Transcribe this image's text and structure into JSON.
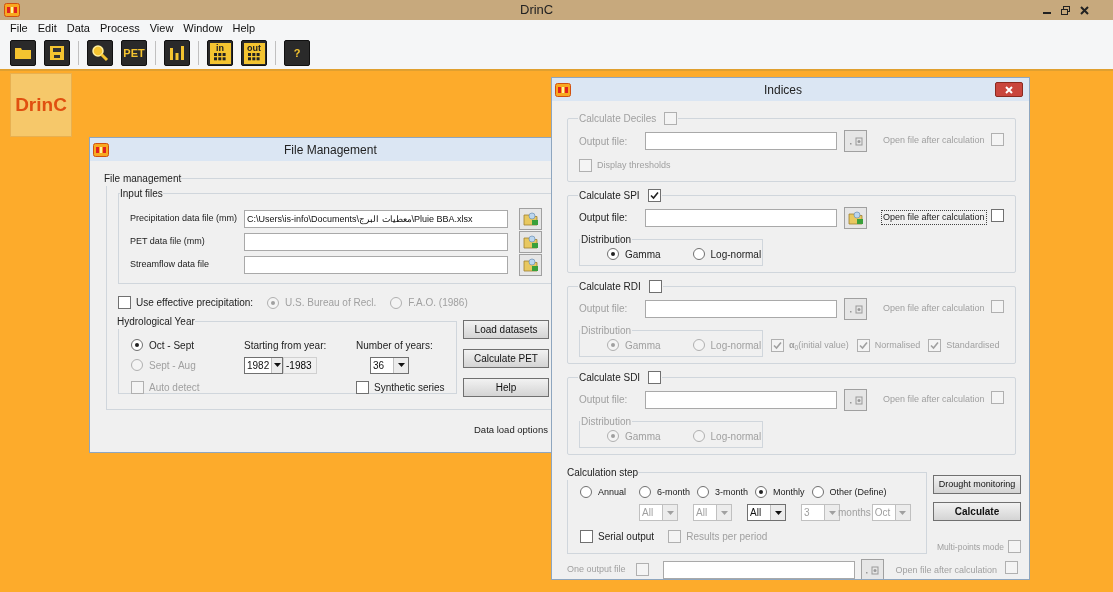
{
  "app": {
    "title": "DrinC",
    "menu": [
      "File",
      "Edit",
      "Data",
      "Process",
      "View",
      "Window",
      "Help"
    ],
    "toolbar_groups": [
      [
        {
          "kind": "folder"
        },
        {
          "kind": "save"
        }
      ],
      [
        {
          "kind": "search"
        },
        {
          "kind": "label",
          "label": "PET"
        }
      ],
      [
        {
          "kind": "chart"
        }
      ],
      [
        {
          "kind": "grid",
          "label": "in"
        },
        {
          "kind": "grid",
          "label": "out"
        }
      ],
      [
        {
          "kind": "label",
          "label": "?"
        }
      ]
    ],
    "logo": "DrinC"
  },
  "file_management": {
    "title": "File Management",
    "group_title": "File management",
    "input_files": {
      "title": "Input files",
      "rows": [
        {
          "label": "Precipitation data file (mm)",
          "value": "C:\\Users\\is-info\\Documents\\معطيات البرج\\Pluie  BBA.xlsx"
        },
        {
          "label": "PET data file (mm)",
          "value": ""
        },
        {
          "label": "Streamflow data file",
          "value": ""
        }
      ]
    },
    "effective": {
      "label": "Use effective precipitation:",
      "checked": false,
      "options": [
        {
          "label": "U.S. Bureau of Recl.",
          "selected": true,
          "disabled": true
        },
        {
          "label": "F.A.O. (1986)",
          "selected": false,
          "disabled": true
        }
      ]
    },
    "hydro": {
      "title": "Hydrological Year",
      "options": [
        {
          "label": "Oct - Sept",
          "selected": true,
          "disabled": false
        },
        {
          "label": "Sept - Aug",
          "selected": false,
          "disabled": true
        }
      ],
      "auto_detect": {
        "label": "Auto detect",
        "checked": false,
        "disabled": true
      },
      "start_label": "Starting from year:",
      "start_year": "1982",
      "end_year": "-1983",
      "years_label": "Number of years:",
      "years": "36",
      "synthetic": {
        "label": "Synthetic series",
        "checked": false,
        "disabled": false
      }
    },
    "buttons": [
      "Load datasets",
      "Calculate PET",
      "Help"
    ],
    "footer": "Data load options"
  },
  "indices": {
    "title": "Indices",
    "sections": [
      {
        "title": "Calculate Deciles",
        "checked": false,
        "disabled": true,
        "output_label": "Output file:",
        "open_label": "Open file after calculation",
        "open_checked": false,
        "open_focused": false,
        "extras": [
          {
            "label": "Display thresholds",
            "checked": false
          }
        ]
      },
      {
        "title": "Calculate SPI",
        "checked": true,
        "disabled": false,
        "output_label": "Output file:",
        "open_label": "Open file after calculation",
        "open_checked": false,
        "open_focused": true,
        "distribution": {
          "title": "Distribution",
          "options": [
            {
              "label": "Gamma",
              "selected": true
            },
            {
              "label": "Log-normal",
              "selected": false
            }
          ]
        }
      },
      {
        "title": "Calculate RDI",
        "checked": false,
        "disabled": false,
        "output_label": "Output file:",
        "open_label": "Open file after calculation",
        "open_checked": false,
        "open_focused": false,
        "distribution": {
          "title": "Distribution",
          "options": [
            {
              "label": "Gamma",
              "selected": true
            },
            {
              "label": "Log-normal",
              "selected": false
            }
          ]
        },
        "extras": [
          {
            "label": "**α**$_{0}$(initial value)",
            "checked": true
          },
          {
            "label": "Normalised",
            "checked": true
          },
          {
            "label": "Standardised",
            "checked": true
          }
        ]
      },
      {
        "title": "Calculate SDI",
        "checked": false,
        "disabled": false,
        "output_label": "Output file:",
        "open_label": "Open file after calculation",
        "open_checked": false,
        "open_focused": false,
        "distribution": {
          "title": "Distribution",
          "options": [
            {
              "label": "Gamma",
              "selected": true
            },
            {
              "label": "Log-normal",
              "selected": false
            }
          ]
        }
      }
    ],
    "calc_step": {
      "title": "Calculation step",
      "options": [
        {
          "label": "Annual",
          "selected": false
        },
        {
          "label": "6-month",
          "selected": false
        },
        {
          "label": "3-month",
          "selected": false
        },
        {
          "label": "Monthly",
          "selected": true
        },
        {
          "label": "Other (Define)",
          "selected": false
        }
      ],
      "selects": [
        {
          "value": "All",
          "disabled": true
        },
        {
          "value": "All",
          "disabled": true
        },
        {
          "value": "All",
          "disabled": false
        },
        {
          "value": "3",
          "disabled": true
        },
        {
          "value": "Oct",
          "disabled": true
        }
      ],
      "months_label": "months",
      "serial": {
        "label": "Serial output",
        "checked": false,
        "disabled": false
      },
      "per_period": {
        "label": "Results per period",
        "checked": false,
        "disabled": true
      }
    },
    "buttons": [
      "Drought monitoring",
      "Calculate"
    ],
    "multi_points": {
      "label": "Multi-points mode",
      "checked": false,
      "disabled": true
    },
    "one_output": {
      "label": "One output file",
      "checked": false,
      "disabled": true,
      "open_label": "Open file after calculation",
      "open_checked": false
    }
  }
}
